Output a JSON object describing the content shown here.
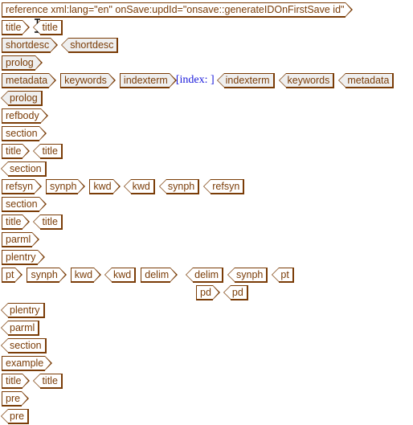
{
  "root_tag": "reference xml:lang=\"en\" onSave:updId=\"onsave::generateIDOnFirstSave id\"",
  "rows": [
    {
      "id": "r1",
      "tags": [
        {
          "label": "title",
          "kind": "open",
          "grey": false
        },
        {
          "label": "title",
          "kind": "close",
          "grey": false
        }
      ]
    },
    {
      "id": "r2",
      "tags": [
        {
          "label": "shortdesc",
          "kind": "open",
          "grey": true
        },
        {
          "label": "shortdesc",
          "kind": "close",
          "grey": true
        }
      ]
    },
    {
      "id": "r3",
      "tags": [
        {
          "label": "prolog",
          "kind": "open",
          "grey": true
        }
      ]
    },
    {
      "id": "r4",
      "tags": [
        {
          "label": "metadata",
          "kind": "open",
          "grey": true
        },
        {
          "label": "keywords",
          "kind": "open",
          "grey": true
        },
        {
          "label": "indexterm",
          "kind": "open",
          "grey": true
        },
        {
          "label": "[index: ]",
          "kind": "text"
        },
        {
          "label": "indexterm",
          "kind": "close",
          "grey": true
        },
        {
          "label": "keywords",
          "kind": "close",
          "grey": true
        },
        {
          "label": "metadata",
          "kind": "close",
          "grey": true
        }
      ]
    },
    {
      "id": "r5",
      "tags": [
        {
          "label": "prolog",
          "kind": "close",
          "grey": true
        }
      ]
    },
    {
      "id": "r6",
      "tags": [
        {
          "label": "refbody",
          "kind": "open",
          "grey": false
        }
      ]
    },
    {
      "id": "r7",
      "tags": [
        {
          "label": "section",
          "kind": "open",
          "grey": false
        }
      ]
    },
    {
      "id": "r8",
      "tags": [
        {
          "label": "title",
          "kind": "open",
          "grey": false
        },
        {
          "label": "title",
          "kind": "close",
          "grey": false
        }
      ]
    },
    {
      "id": "r9",
      "tags": [
        {
          "label": "section",
          "kind": "close",
          "grey": false
        }
      ]
    },
    {
      "id": "r10",
      "tags": [
        {
          "label": "refsyn",
          "kind": "open",
          "grey": false
        },
        {
          "label": "synph",
          "kind": "open",
          "grey": false
        },
        {
          "label": "kwd",
          "kind": "open",
          "grey": false
        },
        {
          "label": "kwd",
          "kind": "close",
          "grey": false
        },
        {
          "label": "synph",
          "kind": "close",
          "grey": false
        },
        {
          "label": "refsyn",
          "kind": "close",
          "grey": false
        }
      ]
    },
    {
      "id": "r11",
      "tags": [
        {
          "label": "section",
          "kind": "open",
          "grey": false
        }
      ]
    },
    {
      "id": "r12",
      "tags": [
        {
          "label": "title",
          "kind": "open",
          "grey": false
        },
        {
          "label": "title",
          "kind": "close",
          "grey": false
        }
      ]
    },
    {
      "id": "r13",
      "tags": [
        {
          "label": "parml",
          "kind": "open",
          "grey": false
        }
      ]
    },
    {
      "id": "r14",
      "tags": [
        {
          "label": "plentry",
          "kind": "open",
          "grey": false
        }
      ]
    },
    {
      "id": "r15",
      "tags": [
        {
          "label": "pt",
          "kind": "open",
          "grey": false
        },
        {
          "label": "synph",
          "kind": "open",
          "grey": false
        },
        {
          "label": "kwd",
          "kind": "open",
          "grey": false
        },
        {
          "label": "kwd",
          "kind": "close",
          "grey": false
        },
        {
          "label": "delim",
          "kind": "open",
          "grey": false
        },
        {
          "label": "delim",
          "kind": "close",
          "grey": false
        },
        {
          "label": "synph",
          "kind": "close",
          "grey": false
        },
        {
          "label": "pt",
          "kind": "close",
          "grey": false
        }
      ]
    },
    {
      "id": "r16",
      "tags": [
        {
          "label": "pd",
          "kind": "open",
          "grey": false
        },
        {
          "label": "pd",
          "kind": "close",
          "grey": false
        }
      ]
    },
    {
      "id": "r17",
      "tags": [
        {
          "label": "plentry",
          "kind": "close",
          "grey": false
        }
      ]
    },
    {
      "id": "r18",
      "tags": [
        {
          "label": "parml",
          "kind": "close",
          "grey": false
        }
      ]
    },
    {
      "id": "r19",
      "tags": [
        {
          "label": "section",
          "kind": "close",
          "grey": false
        }
      ]
    },
    {
      "id": "r20",
      "tags": [
        {
          "label": "example",
          "kind": "open",
          "grey": false
        }
      ]
    },
    {
      "id": "r21",
      "tags": [
        {
          "label": "title",
          "kind": "open",
          "grey": false
        },
        {
          "label": "title",
          "kind": "close",
          "grey": false
        }
      ]
    },
    {
      "id": "r22",
      "tags": [
        {
          "label": "pre",
          "kind": "open",
          "grey": false
        }
      ]
    },
    {
      "id": "r23",
      "tags": [
        {
          "label": "pre",
          "kind": "close",
          "grey": false
        }
      ]
    }
  ],
  "colors": {
    "tag_border": "#7a3c07",
    "tag_text": "#7a3c07",
    "tag_grey_fill": "#efefef",
    "index_text": "#1a1adb"
  }
}
